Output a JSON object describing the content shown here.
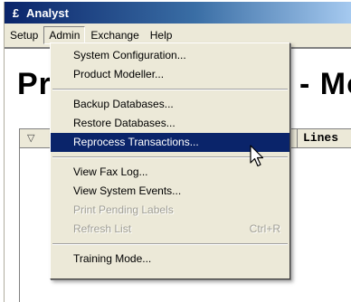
{
  "window": {
    "title": "Analyst",
    "app_icon_glyph": "£"
  },
  "menubar": {
    "items": [
      {
        "label": "Setup"
      },
      {
        "label": "Admin"
      },
      {
        "label": "Exchange"
      },
      {
        "label": "Help"
      }
    ],
    "open_menu": "Admin"
  },
  "background": {
    "title_left": "Pr",
    "title_right": "- Mo",
    "filter_icon": "filter-icon",
    "column_header": "Lines"
  },
  "admin_menu": {
    "groups": [
      [
        {
          "label": "System Configuration...",
          "shortcut": "",
          "state": "normal"
        },
        {
          "label": "Product Modeller...",
          "shortcut": "",
          "state": "normal"
        }
      ],
      [
        {
          "label": "Backup Databases...",
          "shortcut": "",
          "state": "normal"
        },
        {
          "label": "Restore Databases...",
          "shortcut": "",
          "state": "normal"
        },
        {
          "label": "Reprocess Transactions...",
          "shortcut": "",
          "state": "selected"
        }
      ],
      [
        {
          "label": "View Fax Log...",
          "shortcut": "",
          "state": "normal"
        },
        {
          "label": "View System Events...",
          "shortcut": "",
          "state": "normal"
        },
        {
          "label": "Print Pending Labels",
          "shortcut": "",
          "state": "disabled"
        },
        {
          "label": "Refresh List",
          "shortcut": "Ctrl+R",
          "state": "disabled"
        }
      ],
      [
        {
          "label": "Training Mode...",
          "shortcut": "",
          "state": "normal"
        }
      ]
    ]
  },
  "colors": {
    "selection_bg": "#0a246a",
    "menu_bg": "#ece9d8",
    "disabled_text": "#a09f96"
  }
}
